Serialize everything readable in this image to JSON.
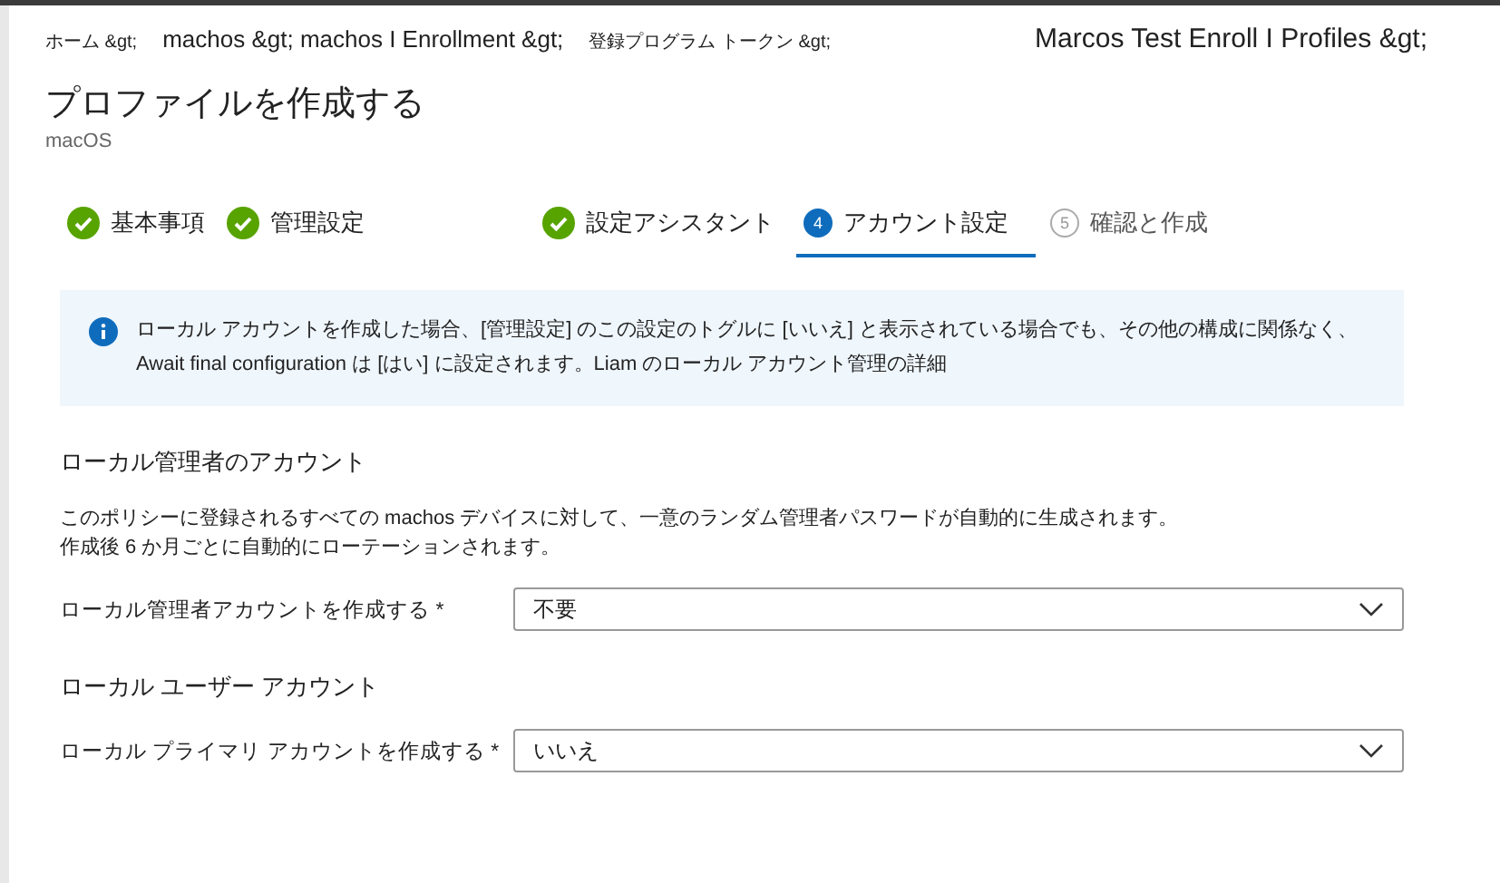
{
  "breadcrumb": [
    "ホーム &gt;",
    "machos &gt; machos I Enrollment &gt;",
    "登録プログラム トークン &gt;",
    "Marcos Test Enroll I Profiles &gt;"
  ],
  "title": "プロファイルを作成する",
  "subtitle": "macOS",
  "steps": [
    {
      "label": "基本事項",
      "kind": "done",
      "selected": false
    },
    {
      "label": "管理設定",
      "kind": "done",
      "selected": false
    },
    {
      "label": "設定アシスタント",
      "kind": "done",
      "selected": false
    },
    {
      "number": "4",
      "label": "アカウント設定",
      "kind": "current",
      "selected": true
    },
    {
      "number": "5",
      "label": "確認と作成",
      "kind": "pending",
      "selected": false
    }
  ],
  "info": "ローカル アカウントを作成した場合、[管理設定] のこの設定のトグルに [いいえ] と表示されている場合でも、その他の構成に関係なく、Await final configuration は [はい] に設定されます。Liam のローカル アカウント管理の詳細",
  "sections": [
    {
      "heading": "ローカル管理者のアカウント",
      "description": [
        "このポリシーに登録されるすべての machos デバイスに対して、一意のランダム管理者パスワードが自動的に生成されます。",
        "作成後 6 か月ごとに自動的にローテーションされます。"
      ],
      "field": {
        "label": "ローカル管理者アカウントを作成する *",
        "value": "不要"
      }
    },
    {
      "heading": "ローカル ユーザー アカウント",
      "field": {
        "label": "ローカル プライマリ アカウントを作成する *",
        "value": "いいえ"
      }
    }
  ]
}
